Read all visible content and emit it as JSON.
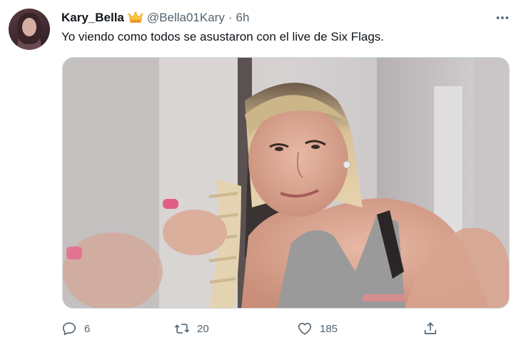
{
  "tweet": {
    "display_name": "Kary_Bella",
    "badge_icon": "crown-emoji-icon",
    "handle": "@Bella01Kary",
    "separator": "·",
    "time": "6h",
    "text": "Yo viendo como todos se asustaron con el live de Six Flags.",
    "media": {
      "icon": "photo-image"
    }
  },
  "actions": {
    "reply_count": "6",
    "retweet_count": "20",
    "like_count": "185"
  },
  "colors": {
    "text_primary": "#0f1419",
    "text_secondary": "#536471",
    "border": "#cfd9de"
  }
}
